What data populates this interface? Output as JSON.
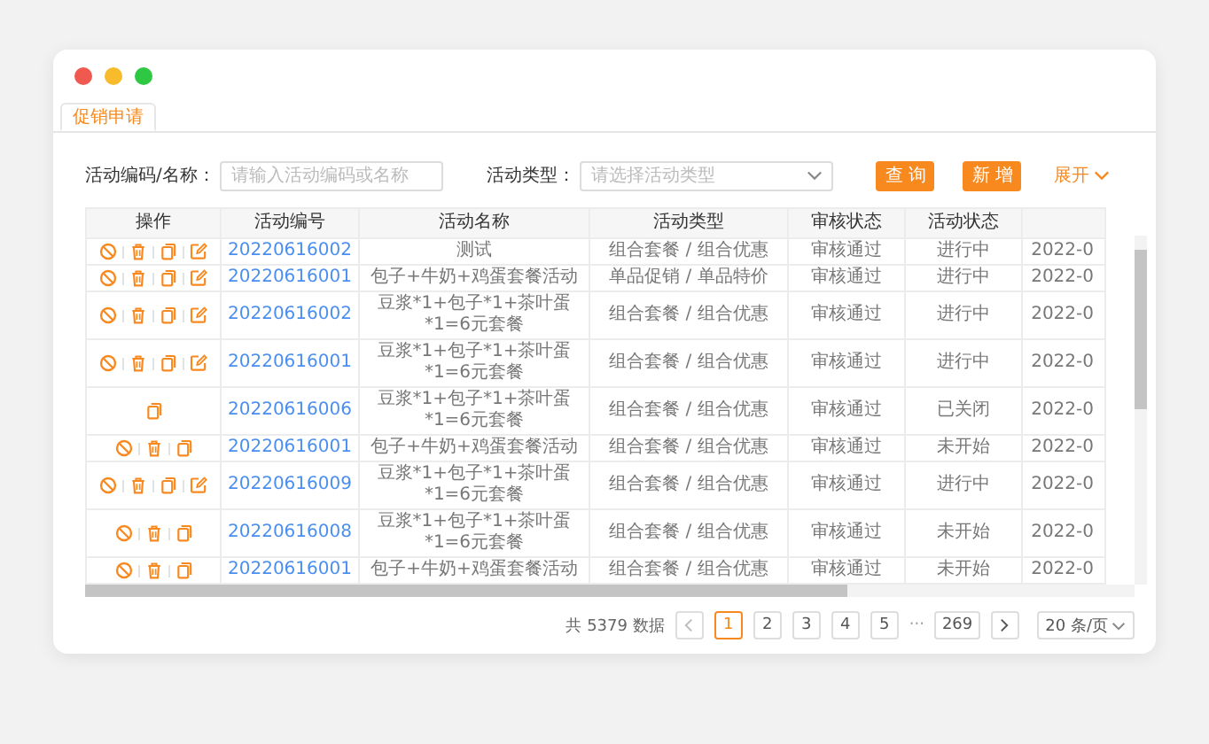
{
  "tabs": [
    {
      "label": "促销申请",
      "selected": true
    }
  ],
  "filters": [
    {
      "kind": "input",
      "label": "活动编码/名称：",
      "placeholder": "请输入活动编码或名称"
    },
    {
      "kind": "select",
      "label": "活动类型：",
      "placeholder": "请选择活动类型"
    }
  ],
  "buttons": [
    {
      "label": "查 询"
    },
    {
      "label": "新 增"
    }
  ],
  "expand": "展开",
  "table": {
    "columns": [
      "操作",
      "活动编号",
      "活动名称",
      "活动类型",
      "审核状态",
      "活动状态"
    ],
    "rows": [
      {
        "actions": [
          {
            "kind": "disable"
          },
          {
            "kind": "delete"
          },
          {
            "kind": "copy"
          },
          {
            "kind": "edit"
          }
        ],
        "code": "20220616002",
        "name": "测试",
        "type": "组合套餐 / 组合优惠",
        "review": "审核通过",
        "status": "进行中",
        "column_7": "2022-0"
      },
      {
        "actions": [
          {
            "kind": "disable"
          },
          {
            "kind": "delete"
          },
          {
            "kind": "copy"
          },
          {
            "kind": "edit"
          }
        ],
        "code": "20220616001",
        "name": "包子+牛奶+鸡蛋套餐活动",
        "type": "单品促销 / 单品特价",
        "review": "审核通过",
        "status": "进行中",
        "column_7": "2022-0"
      },
      {
        "actions": [
          {
            "kind": "disable"
          },
          {
            "kind": "delete"
          },
          {
            "kind": "copy"
          },
          {
            "kind": "edit"
          }
        ],
        "code": "20220616002",
        "name": "豆浆*1+包子*1+茶叶蛋*1=6元套餐",
        "type": "组合套餐 / 组合优惠",
        "review": "审核通过",
        "status": "进行中",
        "column_7": "2022-0"
      },
      {
        "actions": [
          {
            "kind": "disable"
          },
          {
            "kind": "delete"
          },
          {
            "kind": "copy"
          },
          {
            "kind": "edit"
          }
        ],
        "code": "20220616001",
        "name": "豆浆*1+包子*1+茶叶蛋*1=6元套餐",
        "type": "组合套餐 / 组合优惠",
        "review": "审核通过",
        "status": "进行中",
        "column_7": "2022-0"
      },
      {
        "actions": [
          {
            "kind": "copy"
          }
        ],
        "code": "20220616006",
        "name": "豆浆*1+包子*1+茶叶蛋*1=6元套餐",
        "type": "组合套餐 / 组合优惠",
        "review": "审核通过",
        "status": "已关闭",
        "column_7": "2022-0"
      },
      {
        "actions": [
          {
            "kind": "disable"
          },
          {
            "kind": "delete"
          },
          {
            "kind": "copy"
          }
        ],
        "code": "20220616001",
        "name": "包子+牛奶+鸡蛋套餐活动",
        "type": "组合套餐 / 组合优惠",
        "review": "审核通过",
        "status": "未开始",
        "column_7": "2022-0"
      },
      {
        "actions": [
          {
            "kind": "disable"
          },
          {
            "kind": "delete"
          },
          {
            "kind": "copy"
          },
          {
            "kind": "edit"
          }
        ],
        "code": "20220616009",
        "name": "豆浆*1+包子*1+茶叶蛋*1=6元套餐",
        "type": "组合套餐 / 组合优惠",
        "review": "审核通过",
        "status": "进行中",
        "column_7": "2022-0"
      },
      {
        "actions": [
          {
            "kind": "disable"
          },
          {
            "kind": "delete"
          },
          {
            "kind": "copy"
          }
        ],
        "code": "20220616008",
        "name": "豆浆*1+包子*1+茶叶蛋*1=6元套餐",
        "type": "组合套餐 / 组合优惠",
        "review": "审核通过",
        "status": "未开始",
        "column_7": "2022-0"
      },
      {
        "actions": [
          {
            "kind": "disable"
          },
          {
            "kind": "delete"
          },
          {
            "kind": "copy"
          }
        ],
        "code": "20220616001",
        "name": "包子+牛奶+鸡蛋套餐活动",
        "type": "组合套餐 / 组合优惠",
        "review": "审核通过",
        "status": "未开始",
        "column_7": "2022-0"
      }
    ]
  },
  "pagination": {
    "total": "共 5379 数据",
    "pages": [
      {
        "kind": "page",
        "label": "1",
        "selected": true
      },
      {
        "kind": "page",
        "label": "2",
        "selected": false
      },
      {
        "kind": "page",
        "label": "3",
        "selected": false
      },
      {
        "kind": "page",
        "label": "4",
        "selected": false
      },
      {
        "kind": "page",
        "label": "5",
        "selected": false
      },
      {
        "kind": "ellipsis",
        "label": "···",
        "selected": false
      },
      {
        "kind": "page",
        "label": "269",
        "selected": false
      }
    ],
    "page_size": "20 条/页"
  }
}
